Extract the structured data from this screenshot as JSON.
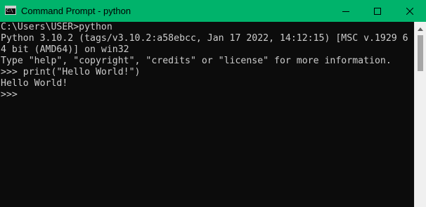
{
  "window": {
    "title": "Command Prompt - python",
    "icon": "cmd-icon",
    "icon_glyph": "C:\\",
    "titlebar_color": "#00b36b",
    "console_bg": "#0c0c0c",
    "console_fg": "#cccccc"
  },
  "controls": {
    "minimize": "minimize-icon",
    "maximize": "maximize-icon",
    "close": "close-icon"
  },
  "console": {
    "lines": [
      "C:\\Users\\USER>python",
      "Python 3.10.2 (tags/v3.10.2:a58ebcc, Jan 17 2022, 14:12:15) [MSC v.1929 6",
      "4 bit (AMD64)] on win32",
      "Type \"help\", \"copyright\", \"credits\" or \"license\" for more information.",
      ">>> print(\"Hello World!\")",
      "Hello World!",
      ">>>"
    ]
  }
}
